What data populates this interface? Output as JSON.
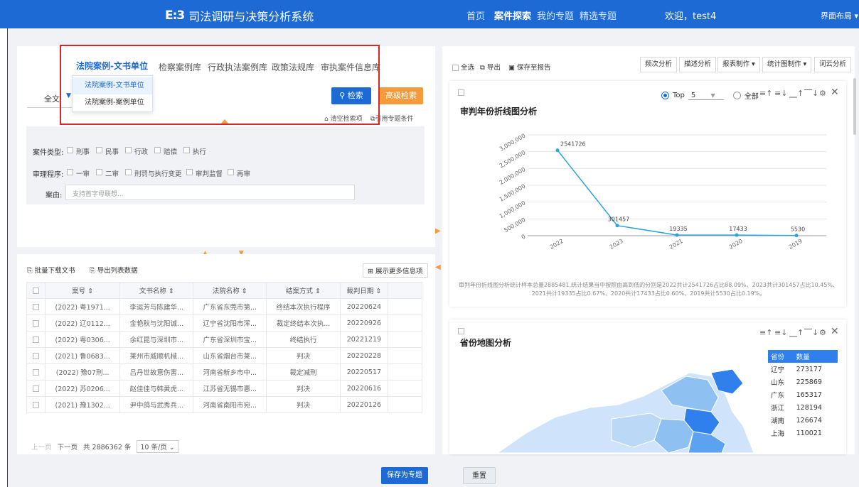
{
  "header": {
    "app_title": "司法调研与决策分析系统",
    "nav": [
      "首页",
      "案件探索",
      "我的专题",
      "精选专题"
    ],
    "welcome": "欢迎，test4",
    "layout_menu": "界面布局 ▾"
  },
  "search": {
    "tabs": [
      "法院案例-文书单位",
      "检察案例库",
      "行政执法案例库",
      "政策法规库",
      "审执案件信息库"
    ],
    "dropdown_items": [
      "法院案例-文书单位",
      "法院案例-案例单位"
    ],
    "scope": "全文",
    "search_button": "检索",
    "advanced_button": "高级检索",
    "clear_link": "清空检索项",
    "ref_link": "引用专题条件"
  },
  "filters": {
    "case_type_label": "案件类型:",
    "case_types": [
      "刑事",
      "民事",
      "行政",
      "赔偿",
      "执行"
    ],
    "procedure_label": "审理程序:",
    "procedures": [
      "一审",
      "二审",
      "刑罚与执行变更",
      "审判监督",
      "再审"
    ],
    "cause_label": "案由:",
    "cause_placeholder": "支持首字母联想..."
  },
  "list": {
    "batch_download": "批量下载文书",
    "export_list": "导出列表数据",
    "more_info": "展示更多信息项",
    "columns": [
      "案号 ⇕",
      "文书名称 ⇕",
      "法院名称 ⇕",
      "结案方式 ⇕",
      "裁判日期 ⇕"
    ],
    "rows": [
      [
        "(2022) 粤1971...",
        "李运芳与陈建华...",
        "广东省东莞市第...",
        "终结本次执行程序",
        "20220624"
      ],
      [
        "(2022) 辽0112...",
        "金艳秋与沈阳诚...",
        "辽宁省沈阳市浑...",
        "裁定终结本次执...",
        "20220926"
      ],
      [
        "(2022) 粤0306...",
        "余红昆与深圳市...",
        "广东省深圳市宝...",
        "终结执行",
        "20221219"
      ],
      [
        "(2021) 鲁0683...",
        "莱州市威顺机械...",
        "山东省烟台市莱...",
        "判决",
        "20220228"
      ],
      [
        "(2022) 豫07刑...",
        "吕丹世故意伤害...",
        "河南省新乡市中...",
        "裁定减刑",
        "20220517"
      ],
      [
        "(2022) 苏0206...",
        "赵佳佳与韩黄虎...",
        "江苏省无锡市惠...",
        "判决",
        "20220616"
      ],
      [
        "(2021) 豫1302...",
        "尹中鸽与武秀兵...",
        "河南省南阳市宛...",
        "判决",
        "20220126"
      ]
    ],
    "pager": {
      "prev": "上一页",
      "next": "下一页",
      "total": "共 2886362 条",
      "page_size": "10 条/页 ⌄"
    }
  },
  "right_toolbar": {
    "select_all": "全选",
    "export": "导出",
    "save_report": "保存至报告",
    "buttons": [
      "频次分析",
      "描述分析",
      "报表制作 ▾",
      "统计图制作 ▾",
      "词云分析"
    ]
  },
  "line_chart": {
    "top_label": "Top",
    "top_value": "5",
    "all_label": "全部",
    "note": "审判年份折线图分析统计样本总量2885481,统计结果当中按照由高到低的分别是2022共计2541726占比88.09%、2023共计301457占比10.45%、2021共计19335占比0.67%、2020共计17433占比0.60%、2019共计5530占比0.19%。"
  },
  "chart_data": {
    "type": "line",
    "title": "审判年份折线图分析",
    "categories": [
      "2022",
      "2023",
      "2021",
      "2020",
      "2019"
    ],
    "values": [
      2541726,
      301457,
      19335,
      17433,
      5530
    ],
    "y_ticks": [
      "0",
      "500,000",
      "1,000,000",
      "1,500,000",
      "2,000,000",
      "2,500,000",
      "3,000,000"
    ],
    "ylim": [
      0,
      3000000
    ],
    "grid": true,
    "color": "#2aa3dd"
  },
  "map_panel": {
    "title": "省份地图分析",
    "table_headers": [
      "省份",
      "数量"
    ],
    "rows": [
      [
        "辽宁",
        "273177"
      ],
      [
        "山东",
        "225869"
      ],
      [
        "广东",
        "165317"
      ],
      [
        "浙江",
        "128194"
      ],
      [
        "湖南",
        "126674"
      ],
      [
        "上海",
        "110021"
      ]
    ]
  },
  "footer": {
    "save_topic": "保存为专题",
    "reset": "重置"
  },
  "colors": {
    "primary": "#1d6ad4",
    "accent": "#f59b3c",
    "highlight": "#d62828"
  }
}
